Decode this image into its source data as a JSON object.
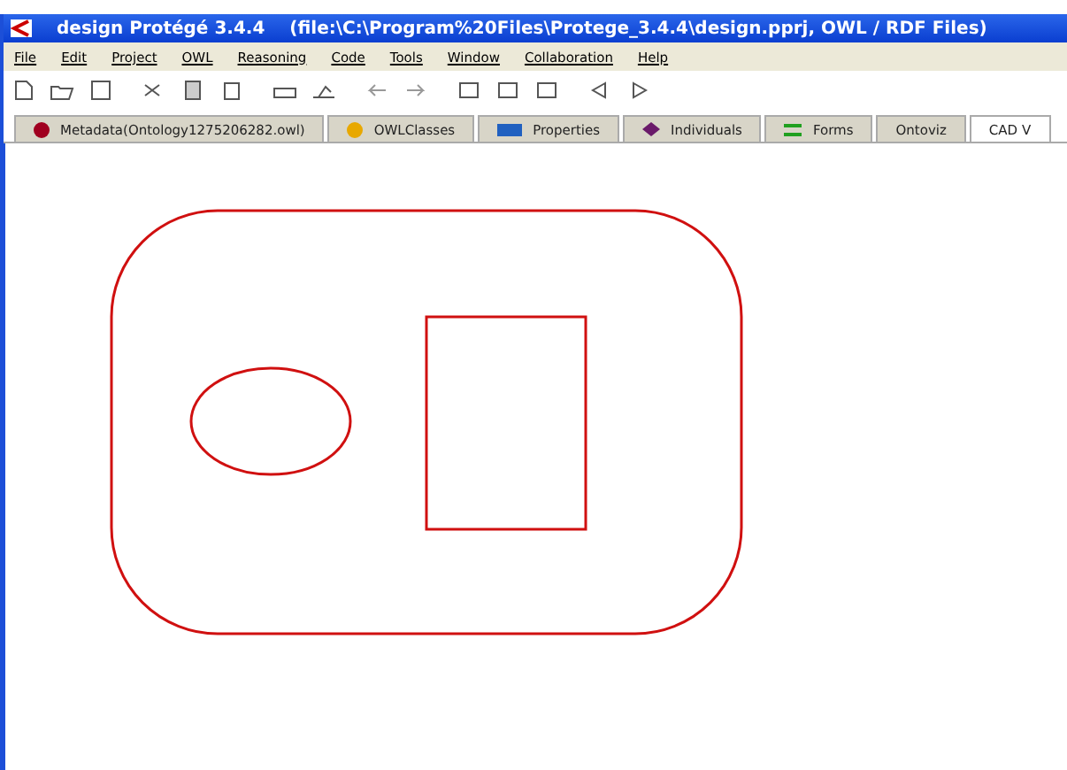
{
  "window": {
    "title": "design  Protégé 3.4.4",
    "path": "(file:\\C:\\Program%20Files\\Protege_3.4.4\\design.pprj, OWL / RDF Files)"
  },
  "menu": [
    "File",
    "Edit",
    "Project",
    "OWL",
    "Reasoning",
    "Code",
    "Tools",
    "Window",
    "Collaboration",
    "Help"
  ],
  "tabs": [
    {
      "label": "Metadata(Ontology1275206282.owl)",
      "selected": false,
      "kind": "dot",
      "color": "#a00020"
    },
    {
      "label": "OWLClasses",
      "selected": false,
      "kind": "dot",
      "color": "#e8a800"
    },
    {
      "label": "Properties",
      "selected": false,
      "kind": "bar",
      "color": "#2060c0"
    },
    {
      "label": "Individuals",
      "selected": false,
      "kind": "diamond",
      "color": "#6a1a6a"
    },
    {
      "label": "Forms",
      "selected": false,
      "kind": "lines",
      "color": "#20a020"
    },
    {
      "label": "Ontoviz",
      "selected": false,
      "kind": "none"
    },
    {
      "label": "CAD V",
      "selected": true,
      "kind": "none"
    }
  ]
}
